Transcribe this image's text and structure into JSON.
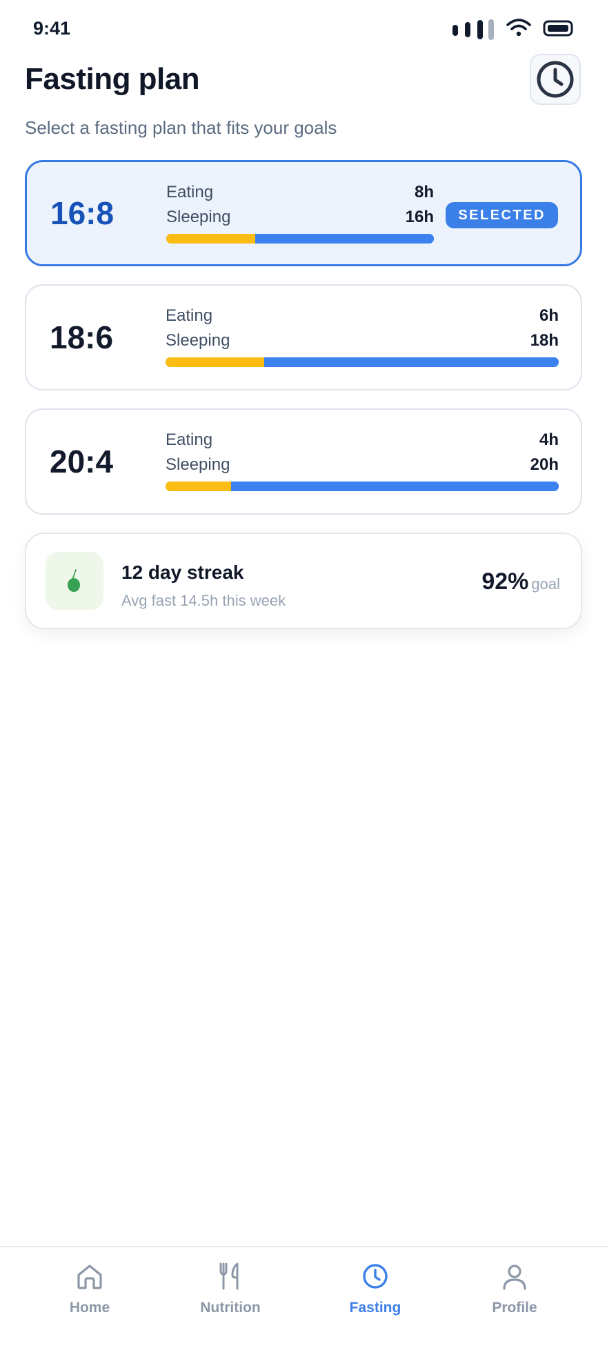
{
  "status_bar": {
    "time": "9:41"
  },
  "header": {
    "title": "Fasting plan",
    "subtitle": "Select a fasting plan that fits your goals"
  },
  "plans": [
    {
      "ratio": "16:8",
      "eating_label": "Eating",
      "eating_value": "8h",
      "sleeping_label": "Sleeping",
      "sleeping_value": "16h",
      "eating_fraction": 0.333,
      "badge": "SELECTED",
      "selected": true
    },
    {
      "ratio": "18:6",
      "eating_label": "Eating",
      "eating_value": "6h",
      "sleeping_label": "Sleeping",
      "sleeping_value": "18h",
      "eating_fraction": 0.25,
      "selected": false
    },
    {
      "ratio": "20:4",
      "eating_label": "Eating",
      "eating_value": "4h",
      "sleeping_label": "Sleeping",
      "sleeping_value": "20h",
      "eating_fraction": 0.167,
      "selected": false
    }
  ],
  "streak": {
    "title": "12 day streak",
    "subtitle": "Avg fast 14.5h this week",
    "percent": "92%",
    "goal_label": "goal"
  },
  "tabs": [
    {
      "label": "Home",
      "icon": "home-icon",
      "active": false
    },
    {
      "label": "Nutrition",
      "icon": "fork-knife-icon",
      "active": false
    },
    {
      "label": "Fasting",
      "icon": "clock-icon",
      "active": true
    },
    {
      "label": "Profile",
      "icon": "person-icon",
      "active": false
    }
  ],
  "colors": {
    "accent": "#3b7fe8",
    "eating": "#fbbd13",
    "sleeping": "#3b82f0",
    "selected_bg": "#edf3fc"
  }
}
